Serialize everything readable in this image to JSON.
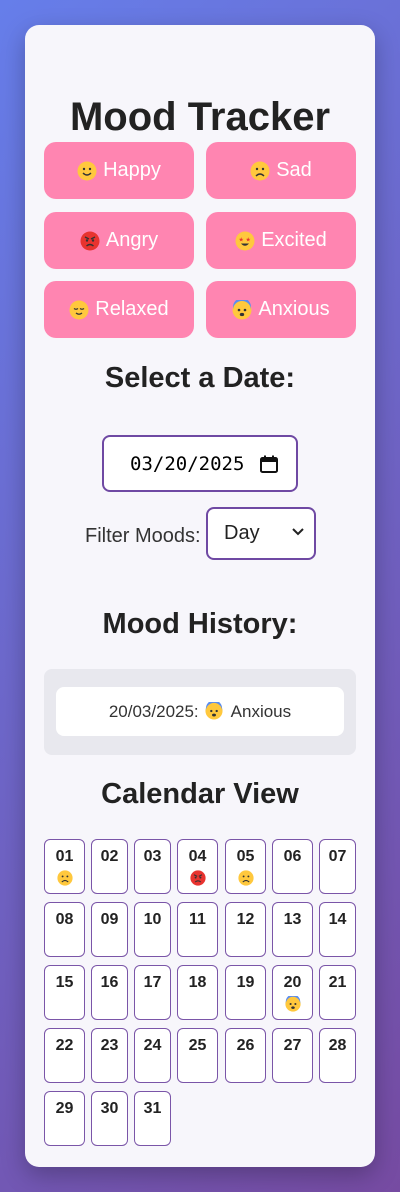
{
  "app": {
    "title": "Mood Tracker"
  },
  "moods": [
    {
      "label": "Happy",
      "icon": "happy-face-icon"
    },
    {
      "label": "Sad",
      "icon": "sad-face-icon"
    },
    {
      "label": "Angry",
      "icon": "angry-face-icon"
    },
    {
      "label": "Excited",
      "icon": "star-struck-face-icon"
    },
    {
      "label": "Relaxed",
      "icon": "relieved-face-icon"
    },
    {
      "label": "Anxious",
      "icon": "anxious-face-icon"
    }
  ],
  "date_section": {
    "heading": "Select a Date:",
    "value": "03/20/2025"
  },
  "filter": {
    "label": "Filter Moods:",
    "selected": "Day"
  },
  "history": {
    "heading": "Mood History:",
    "entries": [
      {
        "date": "20/03/2025:",
        "mood": "Anxious",
        "icon": "anxious-face-icon"
      }
    ]
  },
  "calendar": {
    "heading": "Calendar View",
    "days": [
      "01",
      "02",
      "03",
      "04",
      "05",
      "06",
      "07",
      "08",
      "09",
      "10",
      "11",
      "12",
      "13",
      "14",
      "15",
      "16",
      "17",
      "18",
      "19",
      "20",
      "21",
      "22",
      "23",
      "24",
      "25",
      "26",
      "27",
      "28",
      "29",
      "30",
      "31"
    ],
    "day_moods": {
      "01": "sad-face-icon",
      "04": "angry-face-icon",
      "05": "sad-face-icon",
      "20": "anxious-face-icon"
    }
  },
  "colors": {
    "accent": "#ff85b1",
    "border": "#6f49a3"
  }
}
